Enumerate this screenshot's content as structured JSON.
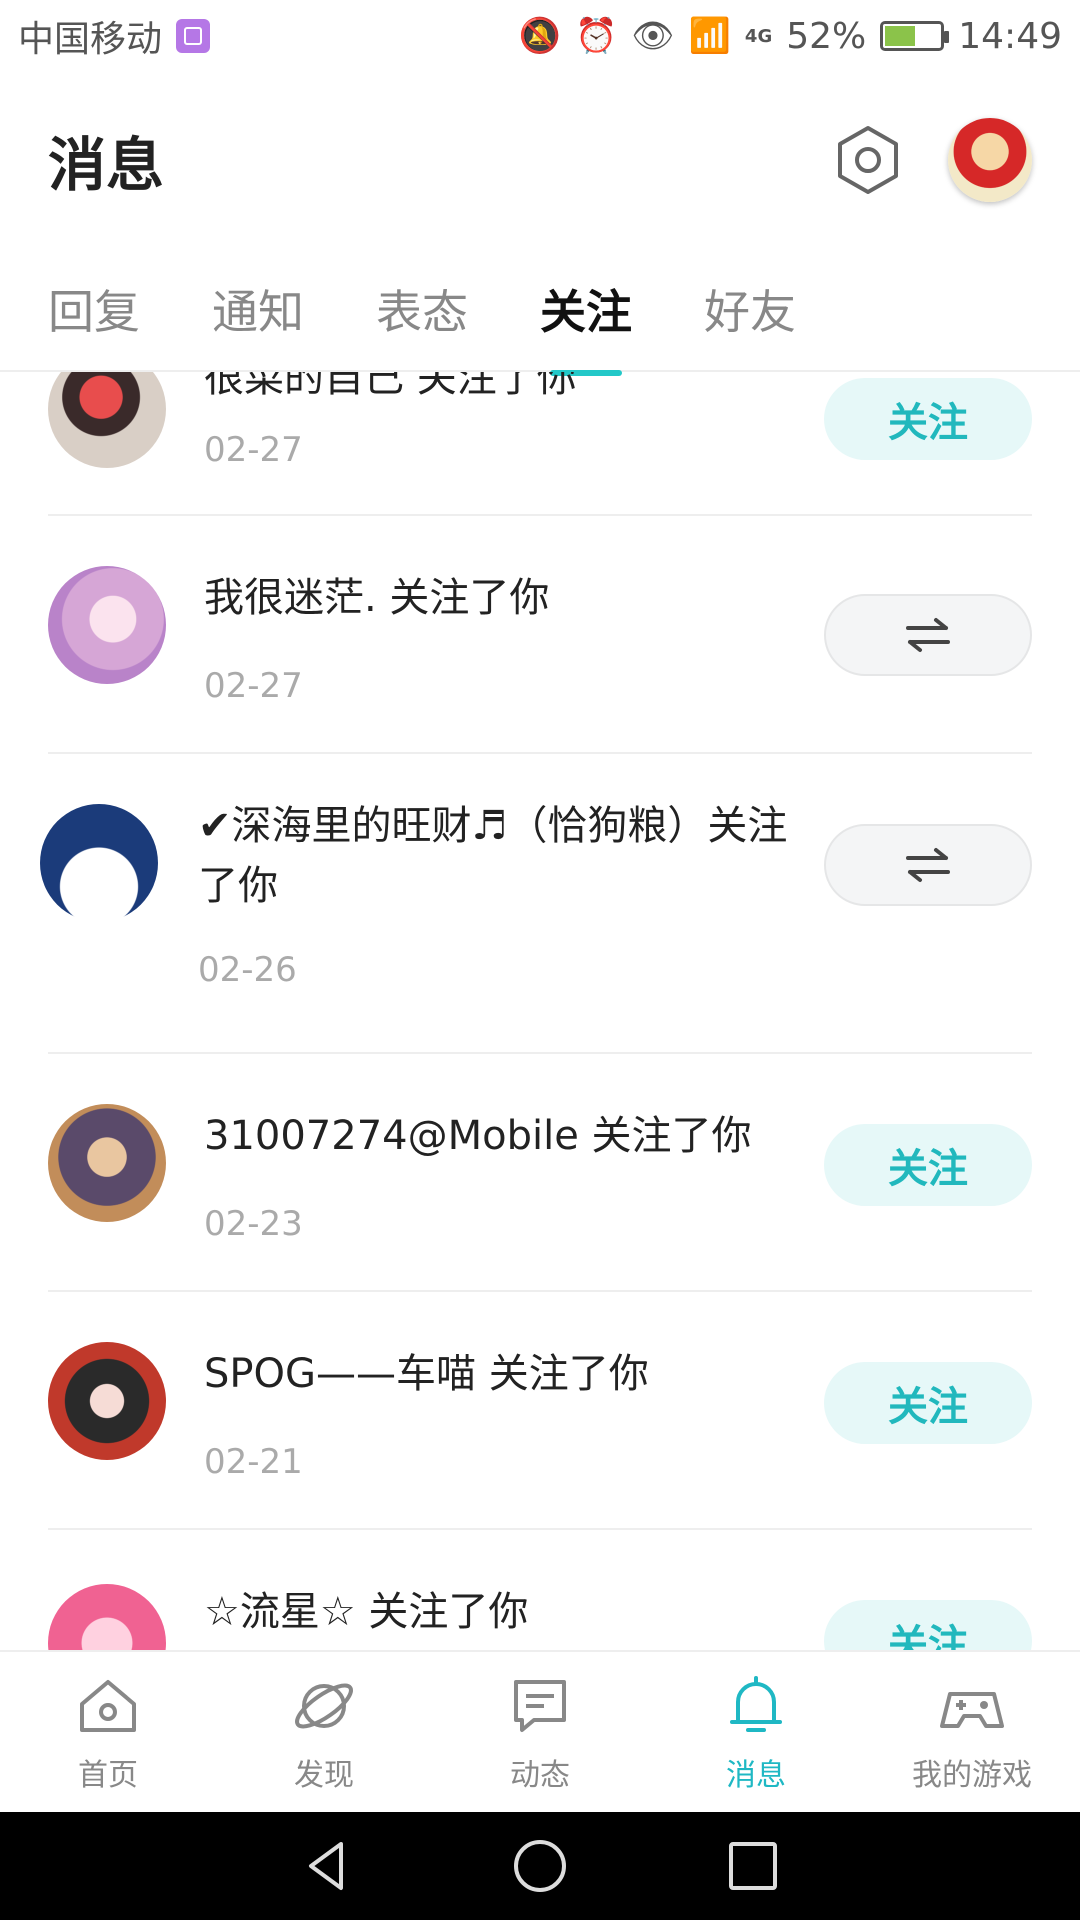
{
  "status_bar": {
    "carrier": "中国移动",
    "network": "4G",
    "battery": "52%",
    "time": "14:49"
  },
  "header": {
    "title": "消息"
  },
  "tabs": [
    {
      "label": "回复",
      "active": false
    },
    {
      "label": "通知",
      "active": false
    },
    {
      "label": "表态",
      "active": false
    },
    {
      "label": "关注",
      "active": true
    },
    {
      "label": "好友",
      "active": false
    }
  ],
  "follows": [
    {
      "name": "很菜的自己 关注了你",
      "date": "02-27",
      "button": "关注",
      "mutual": false
    },
    {
      "name": "我很迷茫. 关注了你",
      "date": "02-27",
      "button": "⇄",
      "mutual": true
    },
    {
      "name": "✔深海里的旺财♬（恰狗粮）关注了你",
      "date": "02-26",
      "button": "⇄",
      "mutual": true
    },
    {
      "name": "31007274@Mobile 关注了你",
      "date": "02-23",
      "button": "关注",
      "mutual": false
    },
    {
      "name": "SPOG——车喵 关注了你",
      "date": "02-21",
      "button": "关注",
      "mutual": false
    },
    {
      "name": "☆流星☆ 关注了你",
      "date": "",
      "button": "关注",
      "mutual": false
    }
  ],
  "bottom_nav": [
    {
      "label": "首页",
      "icon": "home-icon",
      "active": false
    },
    {
      "label": "发现",
      "icon": "planet-icon",
      "active": false
    },
    {
      "label": "动态",
      "icon": "feed-icon",
      "active": false
    },
    {
      "label": "消息",
      "icon": "bell-icon",
      "active": true
    },
    {
      "label": "我的游戏",
      "icon": "gamepad-icon",
      "active": false
    }
  ],
  "colors": {
    "accent": "#21b8bd",
    "follow_bg": "#e6f8f8"
  }
}
